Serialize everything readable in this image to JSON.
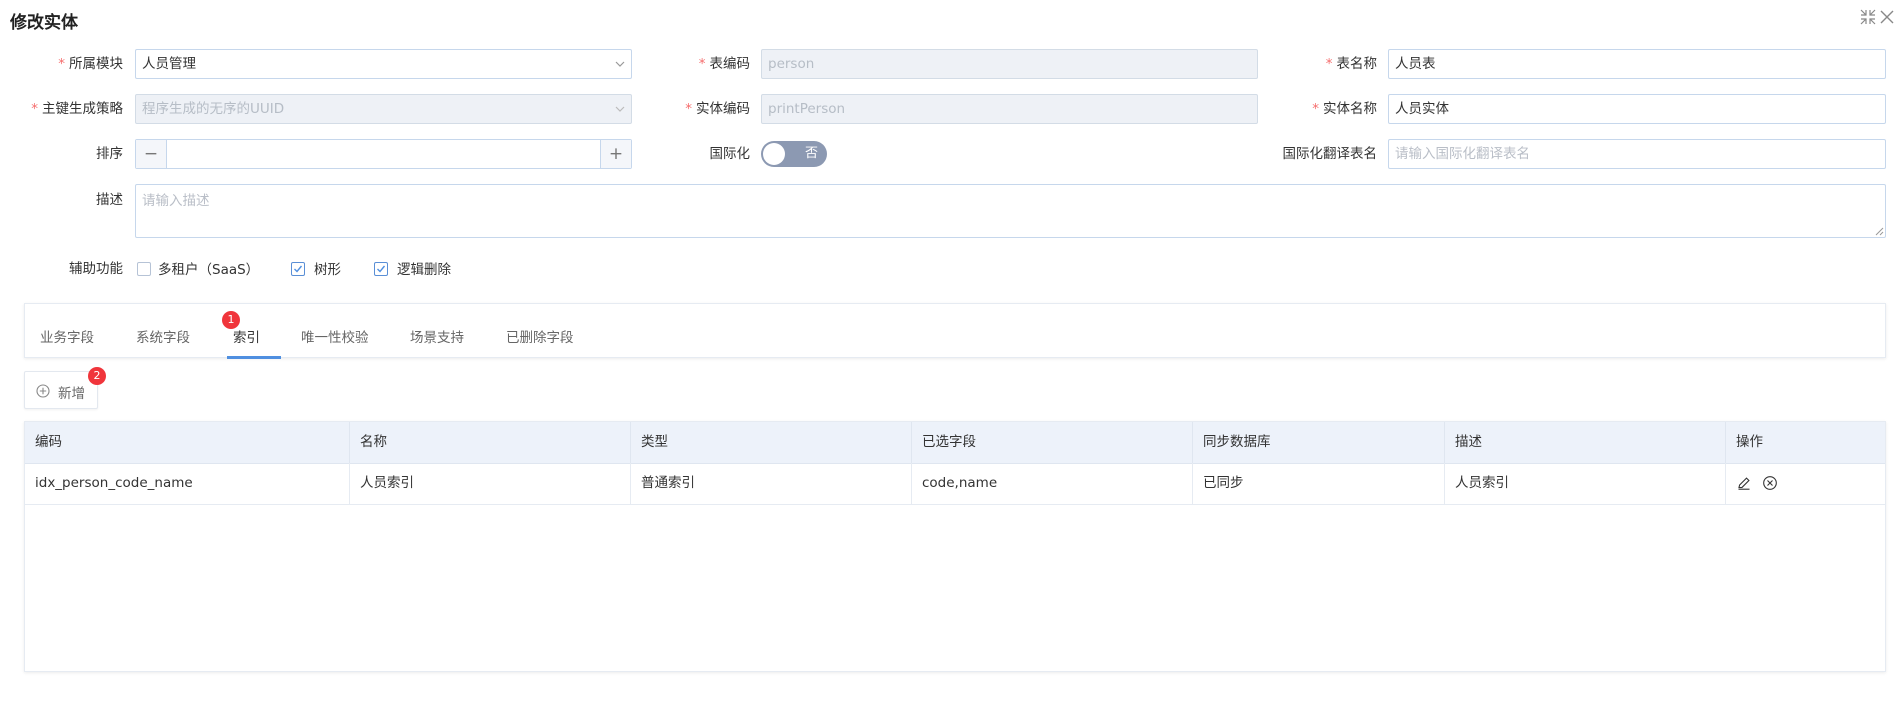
{
  "header": {
    "title": "修改实体"
  },
  "form": {
    "module": {
      "label": "所属模块",
      "value": "人员管理"
    },
    "table_code": {
      "label": "表编码",
      "value": "person"
    },
    "table_name": {
      "label": "表名称",
      "value": "人员表"
    },
    "pk_strategy": {
      "label": "主键生成策略",
      "value": "程序生成的无序的UUID"
    },
    "entity_code": {
      "label": "实体编码",
      "value": "printPerson"
    },
    "entity_name": {
      "label": "实体名称",
      "value": "人员实体"
    },
    "sort": {
      "label": "排序",
      "minus": "−",
      "plus": "+"
    },
    "i18n": {
      "label": "国际化",
      "toggle_text": "否"
    },
    "i18n_table": {
      "label": "国际化翻译表名",
      "placeholder": "请输入国际化翻译表名"
    },
    "description": {
      "label": "描述",
      "placeholder": "请输入描述"
    },
    "aux": {
      "label": "辅助功能",
      "options": [
        {
          "label": "多租户（SaaS）",
          "checked": false
        },
        {
          "label": "树形",
          "checked": true
        },
        {
          "label": "逻辑删除",
          "checked": true
        }
      ]
    }
  },
  "tabs": {
    "items": [
      "业务字段",
      "系统字段",
      "索引",
      "唯一性校验",
      "场景支持",
      "已删除字段"
    ],
    "active_index": 2,
    "badge": "1"
  },
  "toolbar": {
    "add_label": "新增",
    "add_badge": "2"
  },
  "table": {
    "columns": [
      "编码",
      "名称",
      "类型",
      "已选字段",
      "同步数据库",
      "描述",
      "操作"
    ],
    "rows": [
      [
        "idx_person_code_name",
        "人员索引",
        "普通索引",
        "code,name",
        "已同步",
        "人员索引"
      ]
    ]
  },
  "colors": {
    "accent": "#4f8fe0",
    "required": "#f56c6c",
    "badge": "#f0353b",
    "toggle_off": "#8c99b2"
  }
}
